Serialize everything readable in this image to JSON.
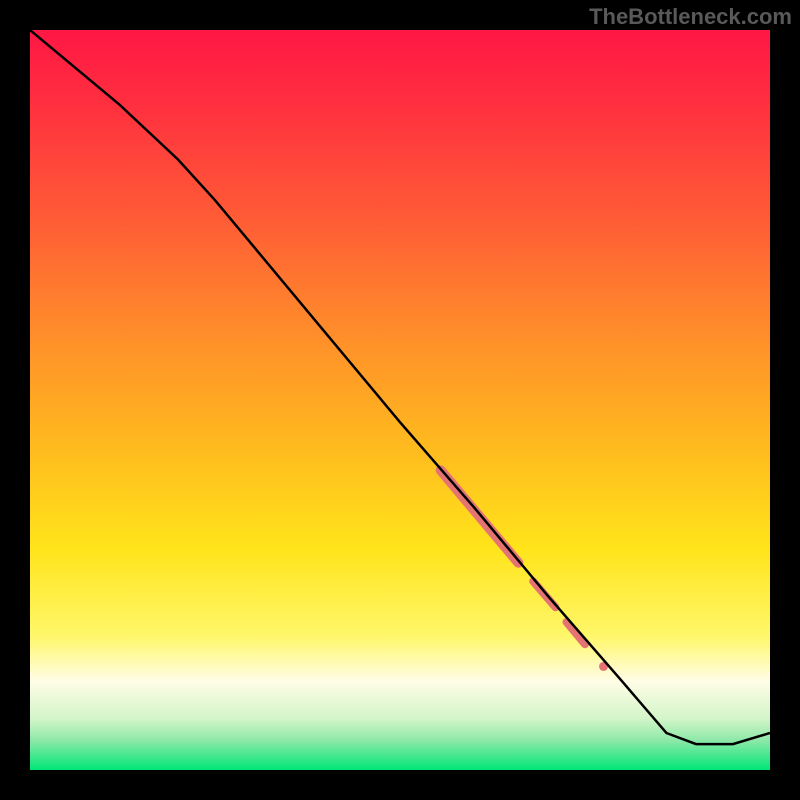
{
  "watermark": "TheBottleneck.com",
  "chart_data": {
    "type": "line",
    "title": "",
    "xlabel": "",
    "ylabel": "",
    "xlim": [
      0,
      100
    ],
    "ylim": [
      0,
      100
    ],
    "gradient_stops": [
      {
        "offset": 0.0,
        "color": "#ff1744"
      },
      {
        "offset": 0.1,
        "color": "#ff2f3f"
      },
      {
        "offset": 0.25,
        "color": "#ff5a36"
      },
      {
        "offset": 0.4,
        "color": "#ff8a2b"
      },
      {
        "offset": 0.55,
        "color": "#ffb61f"
      },
      {
        "offset": 0.7,
        "color": "#ffe41a"
      },
      {
        "offset": 0.82,
        "color": "#fff76b"
      },
      {
        "offset": 0.88,
        "color": "#fffde7"
      },
      {
        "offset": 0.93,
        "color": "#d4f5c9"
      },
      {
        "offset": 0.96,
        "color": "#8de8a8"
      },
      {
        "offset": 1.0,
        "color": "#00e676"
      }
    ],
    "series": [
      {
        "name": "curve",
        "color": "#000000",
        "stroke_width": 2.5,
        "x": [
          0,
          12,
          20,
          25,
          30,
          40,
          50,
          60,
          70,
          80,
          86,
          90,
          95,
          100
        ],
        "y": [
          100,
          90,
          82.5,
          77,
          71,
          59,
          47,
          35.5,
          23.5,
          12,
          5,
          3.5,
          3.5,
          5
        ]
      }
    ],
    "highlight_segments": [
      {
        "x1": 55.5,
        "y1": 40.5,
        "x2": 66,
        "y2": 28,
        "width": 10
      },
      {
        "x1": 68,
        "y1": 25.5,
        "x2": 71,
        "y2": 22,
        "width": 8
      },
      {
        "x1": 72.5,
        "y1": 20,
        "x2": 75,
        "y2": 17,
        "width": 8
      }
    ],
    "highlight_dots": [
      {
        "x": 77.5,
        "y": 14,
        "r": 4.5
      }
    ],
    "highlight_color": "#e57373"
  }
}
